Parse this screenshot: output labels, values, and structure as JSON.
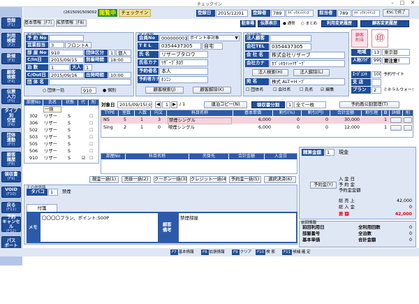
{
  "window": {
    "title": "チェックイン"
  },
  "sidebar": [
    {
      "label": "登録",
      "key": "(F1)"
    },
    {
      "label": "利用\n検索",
      "key": "(F2)"
    },
    {
      "label": "新規",
      "key": "(F3)"
    },
    {
      "label": "顧客\n検索",
      "key": "(F4)"
    },
    {
      "label": "伝票\n入力",
      "key": "(F5)"
    },
    {
      "label": "タイプ\n別\n空室",
      "key": "(F6)"
    },
    {
      "label": "団体\n連動",
      "key": "(F7)"
    },
    {
      "label": "顧客\n履歴",
      "key": "(F8)"
    },
    {
      "label": "領収書",
      "key": "(F9)"
    },
    {
      "label": "VOID",
      "key": "(F10)"
    },
    {
      "label": "戻る",
      "key": "(F11)"
    },
    {
      "label": "予約\nキャンセル",
      "key": "(F12)"
    },
    {
      "label": "パス\nポート",
      "key": ""
    }
  ],
  "header": {
    "code": "(2615091509002)",
    "status": "閲覧中",
    "checkin_btn": "チェックイン",
    "reg_date_label": "登録日",
    "reg_date": "2015/12/01",
    "registrar_label": "登録者",
    "registrar_code": "789",
    "registrar_name": "ﾅﾊﾞｯｸﾒﾝﾃﾅﾝｽ",
    "owner_label": "担当者",
    "owner_code": "789",
    "owner_name": "ﾅﾊﾞｯｸﾒﾝﾃﾅﾝｽ",
    "esc_btn": "ESCで終了"
  },
  "tabs": {
    "basic": "基本情報［F7］",
    "ext": "拡張情報［F8］"
  },
  "toolbar2": {
    "parking": "駐車場",
    "slip_display": "伝票表示",
    "radio_normal": "通常",
    "radio_summary": "まとめ",
    "usage_history": "利用変更履歴",
    "customer_history": "顧客変更履歴"
  },
  "reservation": {
    "title": "予約情報",
    "fields": [
      {
        "label": "予 約 No",
        "value": ""
      },
      {
        "label": "営業担当",
        "value": "3",
        "extra": "フロントA"
      },
      {
        "label": "部 屋 No",
        "value": "910"
      },
      {
        "label": "C/In日",
        "value": "2015/09/15"
      },
      {
        "label": "泊  数",
        "value": "1"
      },
      {
        "label": "C/Out日",
        "value": "2015/09/16"
      },
      {
        "label": "団 体 名",
        "value": ""
      }
    ],
    "group_kubun_label": "団体区分",
    "group_kubun_value": "1",
    "group_kubun_text": "個人",
    "arrival_label": "到着時間",
    "arrival_value": "18:00",
    "adult_label": "大人",
    "adult_value": "1",
    "departure_label": "出発時間",
    "departure_value": "10:00",
    "radio_group": "団体一括",
    "radio_group_value": "910",
    "radio_individual": "個別"
  },
  "personal": {
    "title": "個人情報",
    "member_label": "会員No",
    "member_value": "000000001",
    "point_select": "ポイント非対象",
    "tel_label": "T E L",
    "tel_value": "0354437305",
    "tel_kind": "自宅",
    "name_label": "氏  名",
    "name_value": "リザーブタロウ",
    "kana_label": "氏名カナ",
    "kana_value": "ﾘｻﾞｰﾌﾞﾀﾛｳ",
    "booker_label": "予約者名",
    "booker_value": "本人",
    "booker_kana_label": "予約者カナ",
    "booker_kana_value": "ﾎﾝﾆﾝ",
    "search_btn": "顧客検索(J)",
    "release_btn": "顧客解除(K)"
  },
  "company": {
    "title": "会社情報",
    "corp_label": "法人顧客",
    "corp_value": "",
    "tel_label": "会社TEL",
    "tel_value": "0354437305",
    "name_label": "会 社 名",
    "name_value": "株式会社リザーブ",
    "kana_label": "会社カナ",
    "kana_value": "ｶﾌﾞｼｷｶｲｼｬﾘｻﾞｰﾌﾞ",
    "search_btn": "法人検索(H)",
    "release_btn": "法人解除(L)",
    "title_label": "宛  名",
    "title_value": "株式 ALT+H ｰﾌﾞ",
    "chk_group": "団体名",
    "chk_company": "会社名",
    "chk_name": "氏名",
    "chk_edit": "編集"
  },
  "customer": {
    "badge": "顧客\n削当",
    "area_label": "地域",
    "area_code": "13",
    "area_name": "東京都",
    "person_label": "人物ﾌﾗｸﾞ",
    "person_code": "999",
    "person_name": "要注意！",
    "agent_label": "ｴｰｼﾞｪﾝﾄ",
    "agent_code": "100",
    "agent_name": "予約サイト",
    "branch_label": "支  店",
    "branch_code": "",
    "plan_label": "プラン",
    "plan_code": "2",
    "plan_name": "ミネラルウォータ"
  },
  "rooms_table": {
    "headers": [
      "部屋No",
      "氏名",
      "状態",
      "代",
      "削"
    ],
    "group_row": "一括",
    "rows": [
      {
        "room": "302",
        "name": "リザー",
        "state": "S"
      },
      {
        "room": "306",
        "name": "リザー",
        "state": "S"
      },
      {
        "room": "502",
        "name": "リザー",
        "state": "S"
      },
      {
        "room": "503",
        "name": "リザー",
        "state": "S"
      },
      {
        "room": "505",
        "name": "リザー",
        "state": "S"
      },
      {
        "room": "506",
        "name": "リザー",
        "state": "S"
      },
      {
        "room": "910",
        "name": "リザー",
        "state": "S"
      }
    ]
  },
  "slip": {
    "target_label": "対象日",
    "target_date": "2015/09/15(火)",
    "page": "1",
    "page_total": "/ 1",
    "copy_btn": "連泊コピー(N)",
    "receipt_btn": "領収書分割",
    "receipt_value": "1",
    "receipt_text": "全て一枚",
    "manage_btn": "予約員公割管理(T)",
    "headers": [
      "TYPE",
      "室数",
      "人数",
      "内文",
      "科目名称",
      "基本単価",
      "割引(%)",
      "割引(円)",
      "合計金額",
      "割引理",
      "頁",
      "詳細",
      "削"
    ],
    "rows": [
      {
        "type": "NS",
        "rooms": "5",
        "people": "1",
        "inner": "3",
        "name": "禁煙シングル",
        "price": "6,000",
        "disc_pct": "0",
        "disc_yen": "0",
        "total": "30,000",
        "page": "1"
      },
      {
        "type": "Sing",
        "rooms": "2",
        "people": "1",
        "inner": "0",
        "name": "喫煙シングル",
        "price": "6,000",
        "disc_pct": "0",
        "disc_yen": "0",
        "total": "12,000",
        "page": "1"
      }
    ],
    "sub_headers": [
      "部屋No",
      "科目名称",
      "売掛先",
      "合計金額",
      "入金日"
    ]
  },
  "actions": [
    "現金一括(1)",
    "売掛一括(2)",
    "クーポン一括(3)",
    "クレジット一括(4)",
    "予約金一括(5)",
    "選択決済(6)"
  ],
  "settlement": {
    "label": "精算金額",
    "value": "1",
    "method": "現金",
    "deposit_btn": "予約金(Y)",
    "lines": [
      {
        "label": "入 金 日",
        "value": ""
      },
      {
        "label": "予  約  金",
        "value": ""
      },
      {
        "label": "予約金金額",
        "value": ""
      }
    ],
    "total_sales_label": "総 売 上",
    "total_sales": "42,000",
    "total_paid_label": "総 入 金",
    "total_paid": "0",
    "diff_label": "差  額",
    "diff": "42,000"
  },
  "other": {
    "title": "その他情報",
    "taxo_label": "タバコ",
    "taxo_value": "1",
    "taxo_text": "禁煙",
    "note_tab": "付箋",
    "memo_label": "メモ",
    "memo_value": "〇〇〇〇プラン、ポイント:500P",
    "cust_note_label": "顧客\n備考",
    "cust_note_value": "禁煙部屋"
  },
  "history": {
    "title": "前回情報",
    "prev_date_label": "前回利用日",
    "prev_date": "",
    "count_label": "全利用回数",
    "count": "0",
    "room_label": "部屋番号",
    "room": "",
    "nights_label": "全泊数",
    "nights": "0",
    "price_label": "基本単価",
    "price": "",
    "amount_label": "合計金額",
    "amount": "0"
  },
  "fnbar": [
    {
      "key": "F7",
      "label": "基本情報"
    },
    {
      "key": "F8",
      "label": "拡張情報"
    },
    {
      "key": "F9",
      "label": "クリア"
    },
    {
      "key": "F10",
      "label": "検 索"
    },
    {
      "key": "F11",
      "label": "候補  確 定"
    }
  ],
  "colors": {
    "navy": "#1f4e9c",
    "panel": "#dbe5f5",
    "status": "#2e8b2e",
    "red": "#e00000"
  }
}
